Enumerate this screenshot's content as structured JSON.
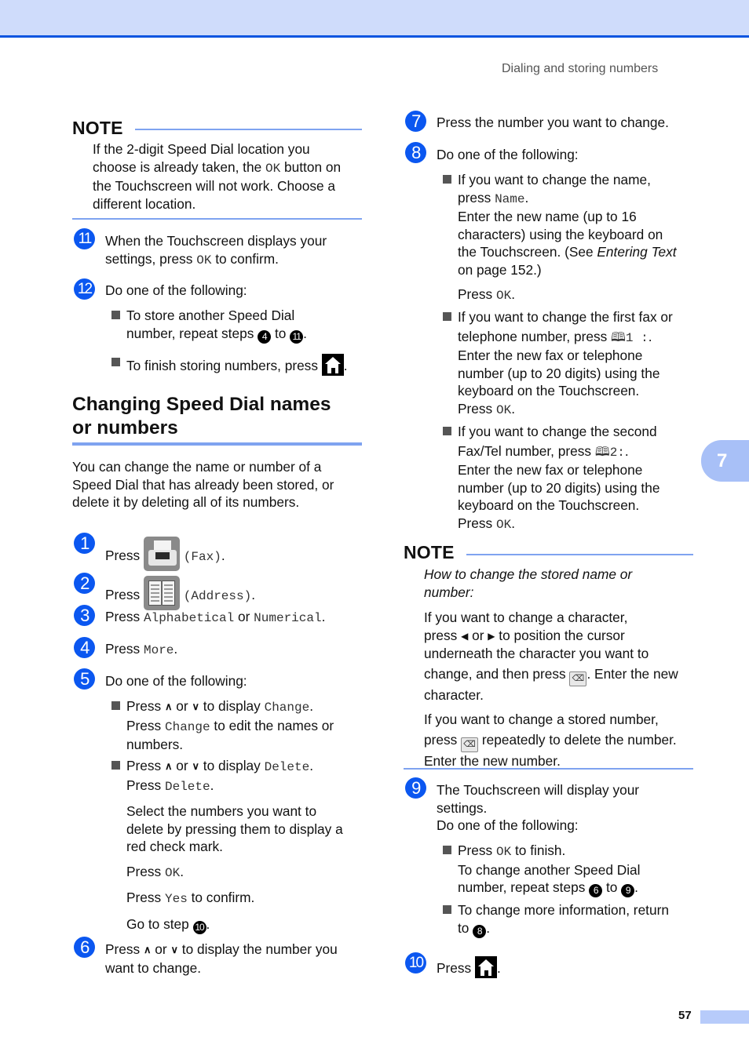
{
  "header": {
    "running_title": "Dialing and storing numbers",
    "band_color": "#cfdcfb",
    "rule_color": "#0a55e0"
  },
  "chapter_tab": {
    "label": "7"
  },
  "footer": {
    "page_number": "57"
  },
  "left_note": {
    "title": "NOTE",
    "body_pre": "If the 2-digit Speed Dial location you",
    "body_line2_pre": "choose is already taken, the ",
    "body_line2_code": "OK",
    "body_line2_post": " button on",
    "body_line3": "the Touchscreen will not work. Choose a",
    "body_line4": "different location."
  },
  "steps_storing": [
    {
      "number": "11",
      "line1": "When the Touchscreen displays your",
      "line2_pre": "settings, press ",
      "line2_code": "OK",
      "line2_post": " to confirm."
    },
    {
      "number": "12",
      "line1": "Do one of the following:",
      "bullets": [
        {
          "line1": "To store another Speed Dial",
          "line2_pre": "number, repeat steps ",
          "ref_from": "4",
          "mid": " to ",
          "ref_to": "11",
          "post": "."
        },
        {
          "line1": "To finish storing numbers, press ",
          "icon": "home-icon",
          "post": "."
        }
      ]
    }
  ],
  "section": {
    "title_line1": "Changing Speed Dial names",
    "title_line2": "or numbers",
    "intro": [
      "You can change the name or number of a",
      "Speed Dial that has already been stored, or",
      "delete it by deleting all of its numbers."
    ]
  },
  "steps_changing": [
    {
      "number": "1",
      "pre": "Press ",
      "icon": "fax-icon",
      "code": "(Fax)",
      "post": "."
    },
    {
      "number": "2",
      "pre": "Press ",
      "icon": "address-book-icon",
      "code": "(Address)",
      "post": "."
    },
    {
      "number": "3",
      "pre": "Press ",
      "code1": "Alphabetical",
      "mid": " or ",
      "code2": "Numerical",
      "post": "."
    },
    {
      "number": "4",
      "pre": "Press ",
      "code": "More",
      "post": "."
    },
    {
      "number": "5",
      "line1": "Do one of the following:",
      "bullets": [
        {
          "press": "Press ",
          "or": " or ",
          "to_display": " to display ",
          "code": "Change",
          "dot": ".",
          "line2_pre": "Press ",
          "line2_code": "Change",
          "line2_post": " to edit the names or",
          "line3": "numbers."
        },
        {
          "press": "Press ",
          "or": " or ",
          "to_display": " to display ",
          "code": "Delete",
          "dot": ".",
          "line2_pre": "Press ",
          "line2_code": "Delete",
          "line2_post": ".",
          "para1": [
            "Select the numbers you want to",
            "delete by pressing them to display a",
            "red check mark."
          ],
          "press_ok_pre": "Press ",
          "press_ok_code": "OK",
          "press_ok_post": ".",
          "press_yes_pre": "Press ",
          "press_yes_code": "Yes",
          "press_yes_post": " to confirm.",
          "goto_pre": "Go to step ",
          "goto_ref": "10",
          "goto_post": "."
        }
      ]
    },
    {
      "number": "6",
      "press": "Press ",
      "or": " or ",
      "post": " to display the number you",
      "line2": "want to change."
    },
    {
      "number": "7",
      "line1": "Press the number you want to change."
    },
    {
      "number": "8",
      "line1": "Do one of the following:",
      "bullets": [
        {
          "line1": "If you want to change the name,",
          "line2_pre": "press ",
          "line2_code": "Name",
          "line2_post": ".",
          "line3": "Enter the new name (up to 16",
          "line4": "characters) using the keyboard on",
          "line5_pre": "the Touchscreen. (See ",
          "line5_italic": "Entering Text",
          "line6": "on page 152.)",
          "press_ok_pre": "Press ",
          "press_ok_code": "OK",
          "press_ok_post": "."
        },
        {
          "line1": "If you want to change the first fax or",
          "line2_pre": "telephone number, press ",
          "line2_code": "1 :",
          "line2_post": ".",
          "line3": "Enter the new fax or telephone",
          "line4": "number (up to 20 digits) using the",
          "line5": "keyboard on the Touchscreen.",
          "press_ok_pre": "Press ",
          "press_ok_code": "OK",
          "press_ok_post": "."
        },
        {
          "line1": "If you want to change the second",
          "line2_pre": "Fax/Tel number, press ",
          "line2_code": "2:",
          "line2_post": ".",
          "line3": "Enter the new fax or telephone",
          "line4": "number (up to 20 digits) using the",
          "line5": "keyboard on the Touchscreen.",
          "press_ok_pre": "Press ",
          "press_ok_code": "OK",
          "press_ok_post": "."
        }
      ]
    },
    {
      "number": "9",
      "line1": "The Touchscreen will display your",
      "line2": "settings.",
      "line3": "Do one of the following:",
      "bullets": [
        {
          "pre": "Press ",
          "code": "OK",
          "post": " to finish.",
          "line2": "To change another Speed Dial",
          "line3_pre": "number, repeat steps ",
          "ref_from": "6",
          "mid": " to ",
          "ref_to": "9",
          "dot": "."
        },
        {
          "line1": "To change more information, return",
          "line2_pre": "to ",
          "ref": "8",
          "dot": "."
        }
      ]
    },
    {
      "number": "10",
      "pre": "Press ",
      "icon": "home-icon",
      "post": "."
    }
  ],
  "right_note": {
    "title": "NOTE",
    "italic_line1": "How to change the stored name or",
    "italic_line2": "number:",
    "p1_line1": "If you want to change a character,",
    "p1_line2_pre": "press ",
    "p1_line2_or": " or ",
    "p1_line2_post": " to position the cursor",
    "p1_line3": "underneath the character you want to",
    "p1_line4_pre": "change, and then press ",
    "p1_line4_post": ". Enter the new",
    "p1_line5": "character.",
    "p2_line1": "If you want to change a stored number,",
    "p2_line2_pre": "press ",
    "p2_line2_post": " repeatedly to delete the number.",
    "p2_line3": "Enter the new number."
  }
}
